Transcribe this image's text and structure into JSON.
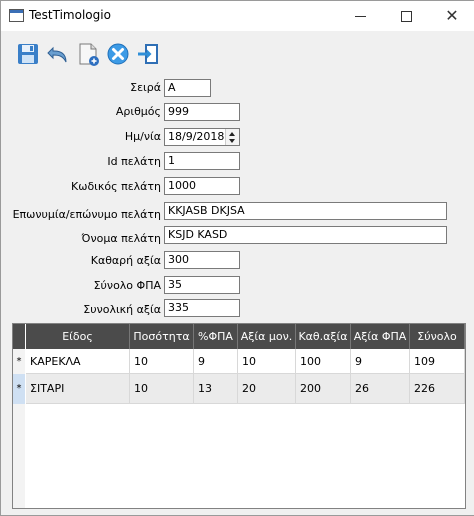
{
  "window": {
    "title": "TestTimologio"
  },
  "toolbar": {
    "icons": [
      "save-icon",
      "undo-icon",
      "new-document-icon",
      "delete-icon",
      "exit-icon"
    ]
  },
  "form": {
    "seira_label": "Σειρά",
    "seira_value": "Α",
    "arithmos_label": "Αριθμός",
    "arithmos_value": "999",
    "date_label": "Ημ/νία",
    "date_value": "18/9/2018",
    "client_id_label": "Id πελάτη",
    "client_id_value": "1",
    "client_code_label": "Κωδικός πελάτη",
    "client_code_value": "1000",
    "company_label": "Επωνυμία/επώνυμο πελάτη",
    "company_value": "KKJASB DKJSA",
    "client_name_label": "Όνομα πελάτη",
    "client_name_value": "KSJD KASD",
    "net_label": "Καθαρή αξία",
    "net_value": "300",
    "vat_label": "Σύνολο ΦΠΑ",
    "vat_value": "35",
    "total_label": "Συνολική αξία",
    "total_value": "335"
  },
  "table": {
    "columns": [
      "Είδος",
      "Ποσότητα",
      "%ΦΠΑ",
      "Αξία μον.",
      "Καθ.αξία",
      "Αξία ΦΠΑ",
      "Σύνολο"
    ],
    "rows": [
      {
        "marker": "*",
        "cells": [
          "ΚΑΡΕΚΛΑ",
          "10",
          "9",
          "10",
          "100",
          "9",
          "109"
        ]
      },
      {
        "marker": "*",
        "cells": [
          "ΣΙΤΑΡΙ",
          "10",
          "13",
          "20",
          "200",
          "26",
          "226"
        ]
      }
    ]
  }
}
